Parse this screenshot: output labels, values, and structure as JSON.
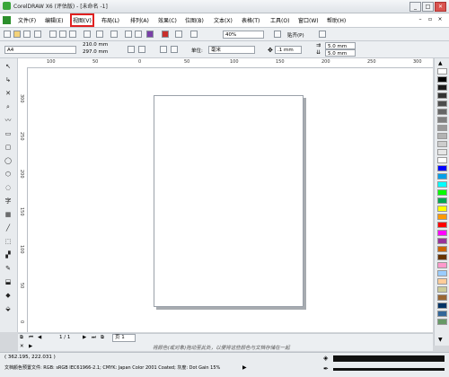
{
  "window": {
    "title": "CorelDRAW X6 (评估版) - [未命名 -1]",
    "minimize": "_",
    "maximize": "□",
    "close": "✕"
  },
  "menus": [
    "文件(F)",
    "编辑(E)",
    "视图(V)",
    "布局(L)",
    "排列(A)",
    "效果(C)",
    "位图(B)",
    "文本(X)",
    "表格(T)",
    "工具(O)",
    "窗口(W)",
    "帮助(H)"
  ],
  "menu_controls": [
    "–",
    "▫",
    "×"
  ],
  "standard_toolbar": {
    "zoom_value": "40%",
    "snap_label": "贴齐(P)"
  },
  "property_bar": {
    "paper_size": "A4",
    "width": "210.0 mm",
    "height": "297.0 mm",
    "units_label": "单位:",
    "units_value": "毫米",
    "nudge": ".1 mm",
    "dup_x": "5.0 mm",
    "dup_y": "5.0 mm"
  },
  "ruler": {
    "h_labels": [
      "100",
      "50",
      "0",
      "50",
      "100",
      "150",
      "200",
      "250",
      "300"
    ],
    "v_labels": [
      "300",
      "250",
      "200",
      "150",
      "100",
      "50",
      "0"
    ],
    "unit": "毫米"
  },
  "tools": [
    "↖",
    "↳",
    "✕",
    "⌕",
    "〰",
    "▭",
    "▢",
    "◯",
    "⬡",
    "◌",
    "字",
    "▦",
    "╱",
    "⬚",
    "▞",
    "✎",
    "⬓",
    "◆",
    "⬙"
  ],
  "palette_colors": [
    "#ffffff",
    "#000000",
    "#1a1a1a",
    "#333333",
    "#4d4d4d",
    "#666666",
    "#808080",
    "#999999",
    "#b3b3b3",
    "#cccccc",
    "#e6e6e6",
    "#ffffff",
    "#0000ff",
    "#00a0e9",
    "#00ffff",
    "#00ff00",
    "#00a651",
    "#ffff00",
    "#ff9900",
    "#ff0000",
    "#ff00ff",
    "#993399",
    "#cc6600",
    "#663300",
    "#ff99cc",
    "#99ccff",
    "#ffcc99",
    "#cccc99",
    "#996633",
    "#003366",
    "#336699",
    "#669966"
  ],
  "navigator": {
    "page_counter": "1 / 1",
    "page_tab": "页 1"
  },
  "hint_text": "将颜色(或对象)拖动至此处，以便将这些颜色与文档存储在一起",
  "status": {
    "coords": "( 362.195, 222.031 )",
    "color_profile": "文档颜色预置文件: RGB: sRGB IEC61966-2.1; CMYK: Japan Color 2001 Coated; 灰度: Dot Gain 15%"
  }
}
